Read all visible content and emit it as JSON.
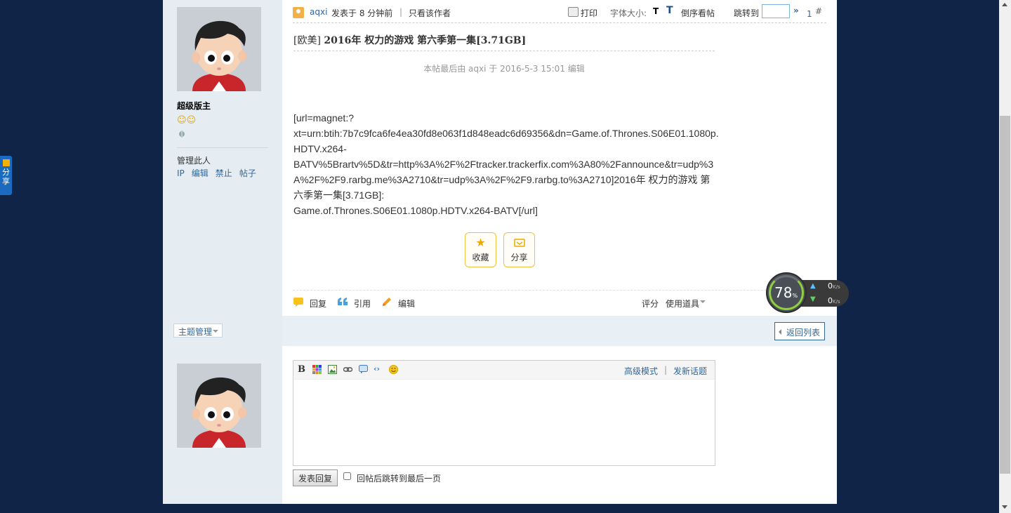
{
  "post": {
    "author": "aqxi",
    "posted_time": "发表于 8 分钟前",
    "only_author": "只看该作者",
    "print": "打印",
    "font_size_label": "字体大小:",
    "font_size_t": "T",
    "reverse_label": "倒序看帖",
    "jump_label": "跳转到",
    "jump_value": "",
    "jump_go": "»",
    "floor_number": "1",
    "floor_hash": "#",
    "title_prefix": "[欧美]",
    "title": "2016年 权力的游戏 第六季第一集[3.71GB]",
    "edit_note": "本帖最后由 aqxi 于 2016-5-3 15:01 编辑",
    "body": "[url=magnet:?\nxt=urn:btih:7b7c9fca6fe4ea30fd8e063f1d848eadc6d69356&dn=Game.of.Thrones.S06E01.1080p.HDTV.x264-\nBATV%5Brartv%5D&tr=http%3A%2F%2Ftracker.trackerfix.com%3A80%2Fannounce&tr=udp%3A%2F%2F9.rarbg.me%3A2710&tr=udp%3A%2F%2F9.rarbg.to%3A2710]2016年 权力的游戏 第六季第一集[3.71GB]:\nGame.of.Thrones.S06E01.1080p.HDTV.x264-BATV[/url]",
    "favorite": "收藏",
    "share": "分享",
    "reply": "回复",
    "quote": "引用",
    "edit": "编辑",
    "rate": "评分",
    "tools": "使用道具"
  },
  "sidebar": {
    "group": "超级版主",
    "manage_title": "管理此人",
    "manage_links": [
      "IP",
      "编辑",
      "禁止",
      "帖子"
    ]
  },
  "manage_bar": {
    "topic_manage": "主题管理",
    "back_to_list": "返回列表"
  },
  "reply_box": {
    "advanced_mode": "高级模式",
    "separator": "|",
    "new_topic": "发新话题",
    "submit": "发表回复",
    "jump_last": "回帖后跳转到最后一页"
  },
  "side_share": {
    "label_line1": "分",
    "label_line2": "享"
  },
  "net_widget": {
    "percent": "78",
    "percent_unit": "%",
    "upload": "0",
    "download": "0",
    "unit": "K/s"
  },
  "colors": {
    "page_bg": "#0f2446",
    "sidebar_bg": "#e5edf2",
    "link": "#336699",
    "accent_yellow": "#f0c040"
  }
}
